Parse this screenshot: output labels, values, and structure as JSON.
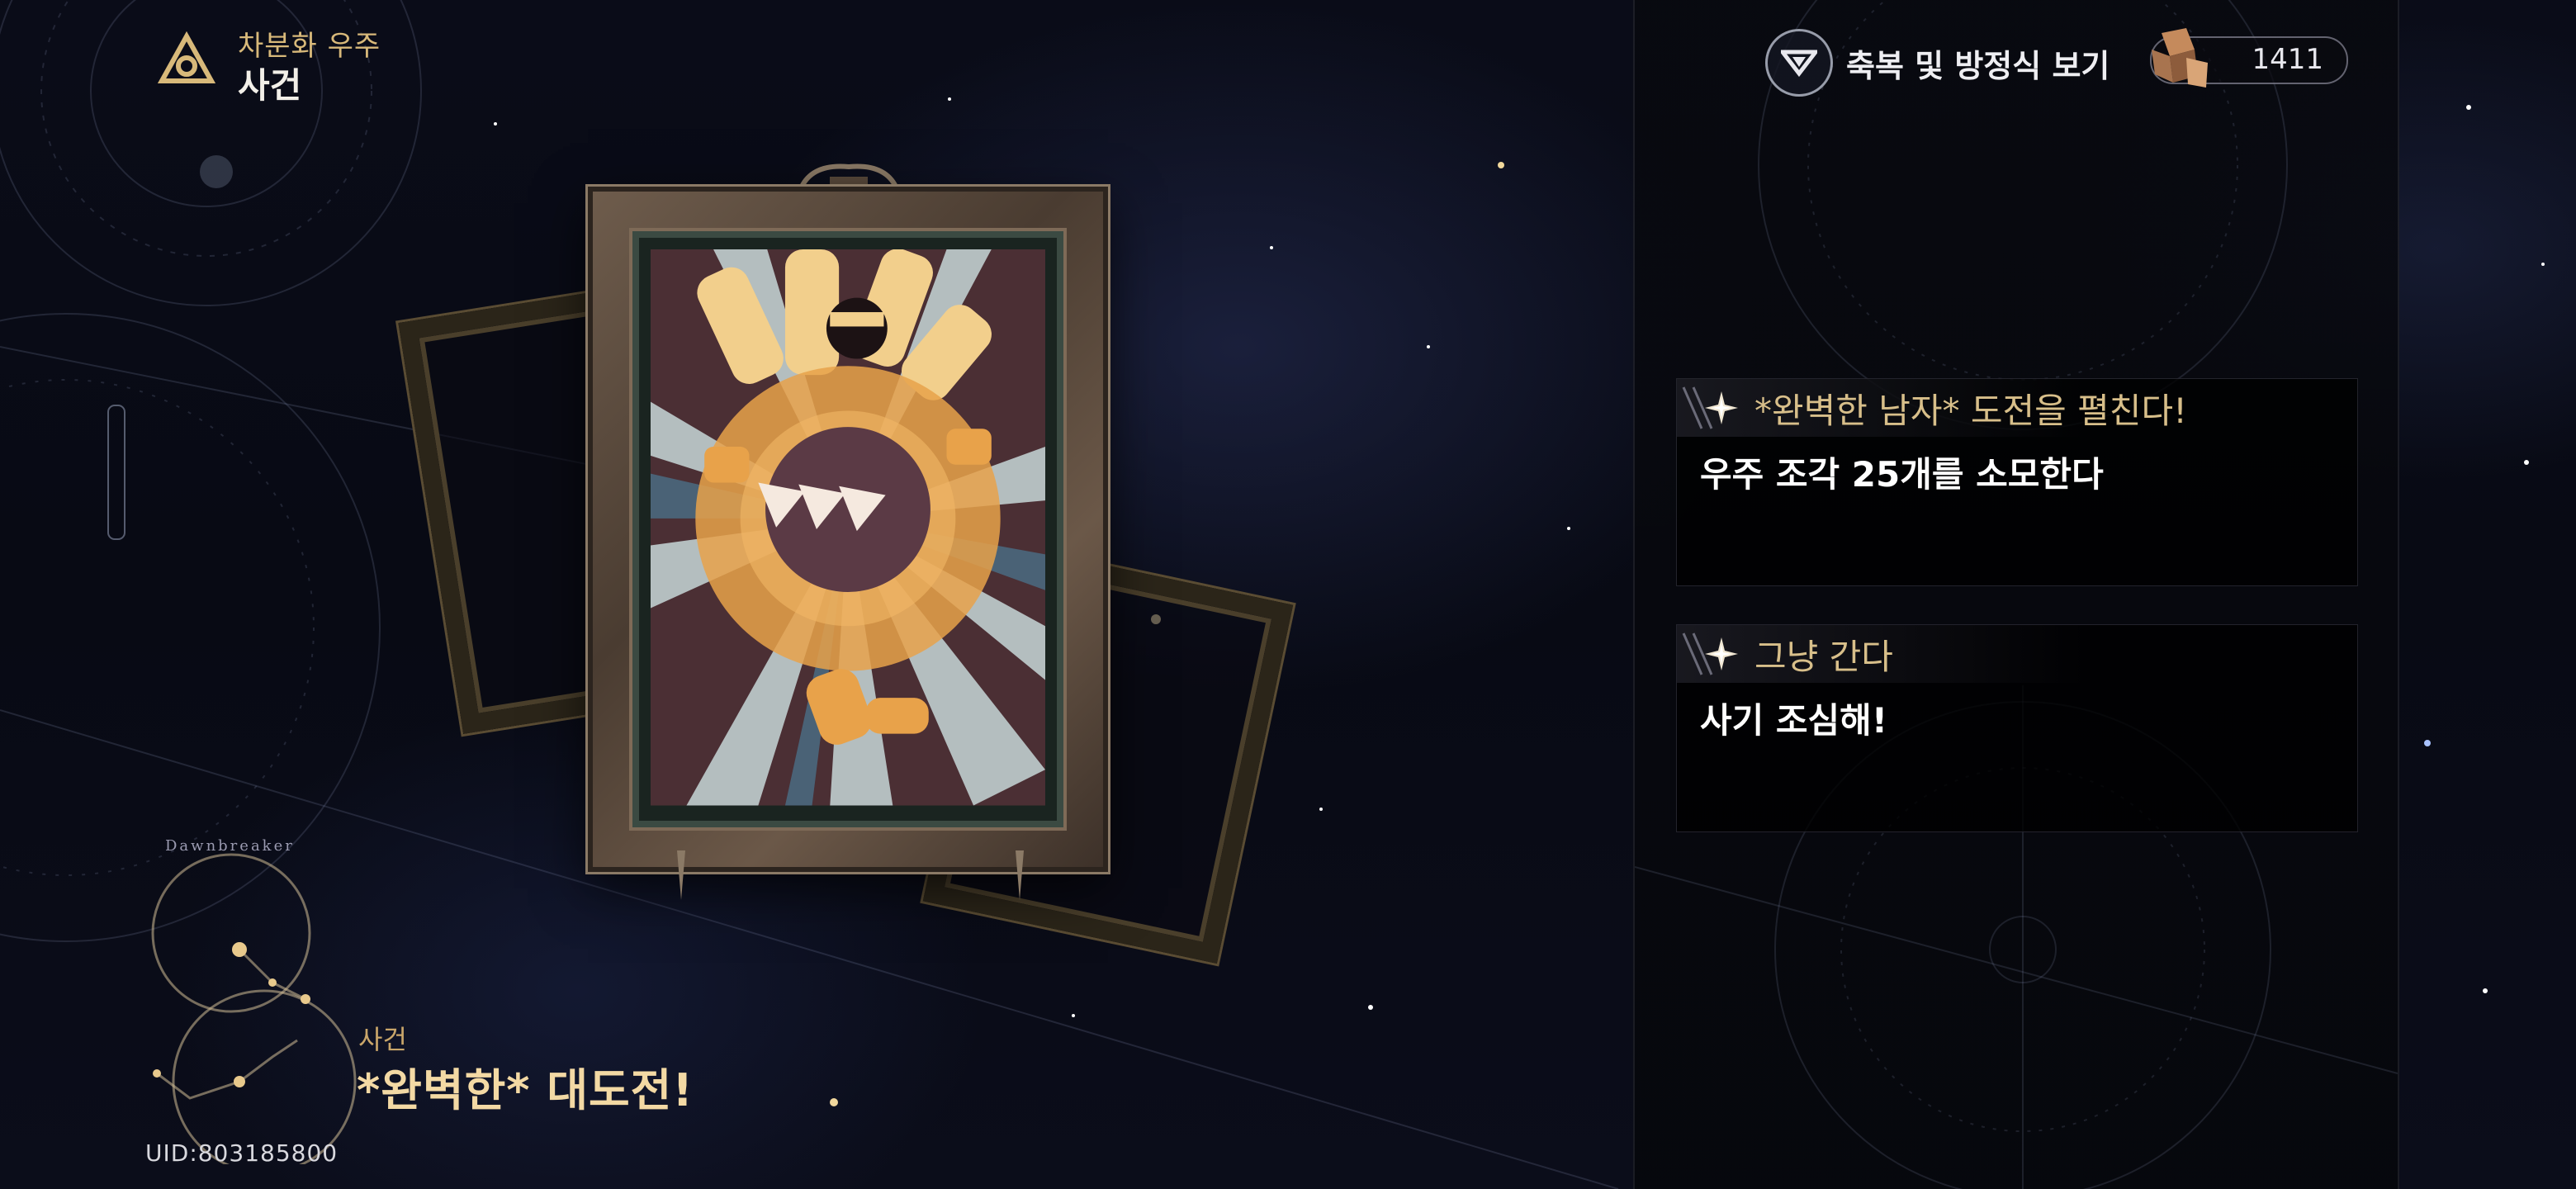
{
  "header": {
    "location_sub": "차분화 우주",
    "location_title": "사건",
    "location_icon": "triquetra-icon"
  },
  "top_right": {
    "blessing_label": "축복 및 방정식 보기",
    "blessing_icon": "chevron-down-triangle-icon",
    "currency_value": "1411",
    "currency_icon": "cube-fragment-icon"
  },
  "event": {
    "kicker": "사건",
    "title": "*완벽한* 대도전!",
    "constellation_label": "Dawnbreaker"
  },
  "options": [
    {
      "title": "*완벽한 남자* 도전을 펼친다!",
      "desc": "우주 조각 25개를 소모한다"
    },
    {
      "title": "그냥 간다",
      "desc": "사기 조심해!"
    }
  ],
  "footer": {
    "uid": "UID:803185800"
  },
  "colors": {
    "gold": "#d8bf8a",
    "title_gold": "#f3d9a4",
    "panel_bg": "#08090e",
    "card_frame": "#6e5c4c"
  }
}
